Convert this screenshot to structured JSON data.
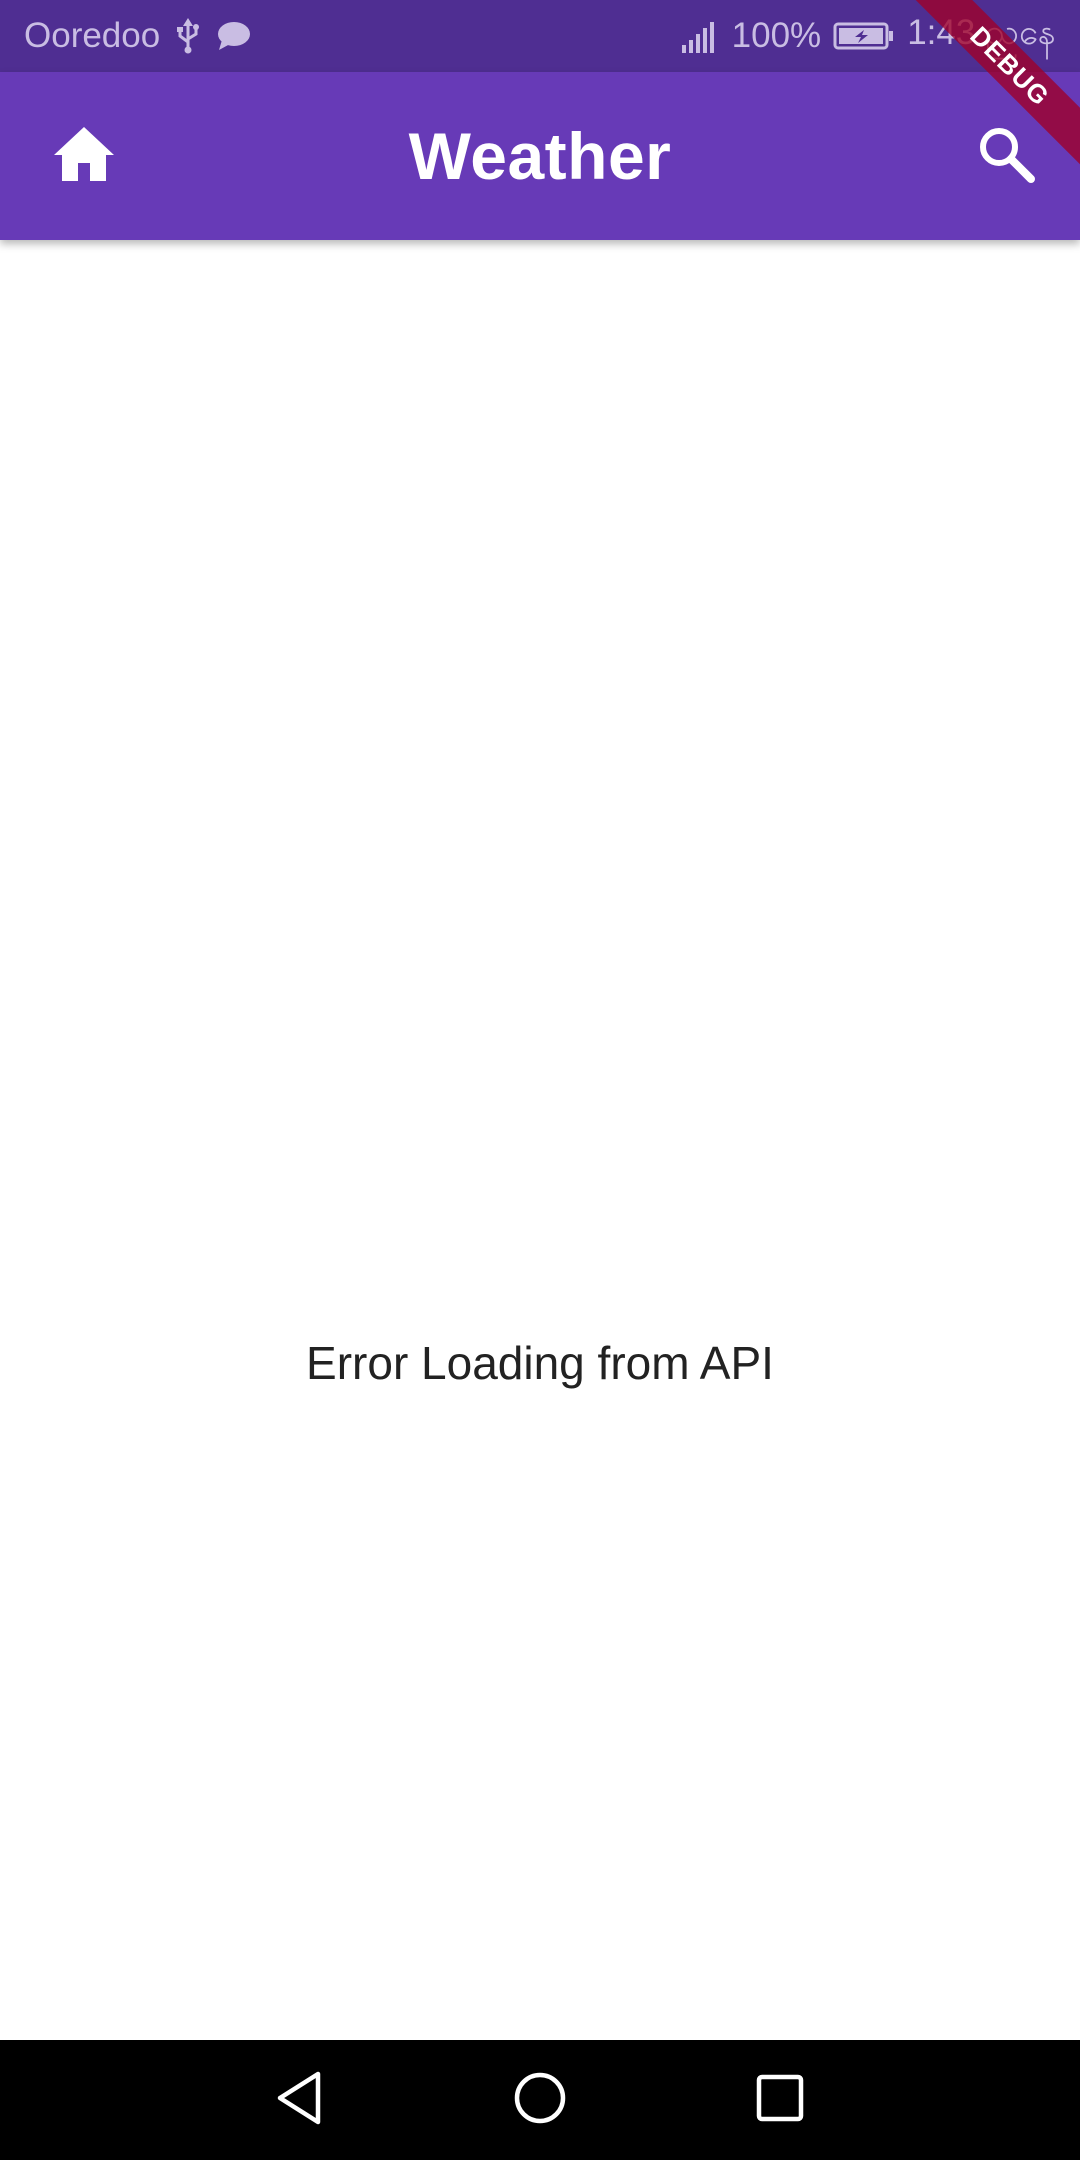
{
  "status_bar": {
    "carrier": "Ooredoo",
    "battery": "100%",
    "time": "1:43 ညနေ",
    "icons": [
      "usb-icon",
      "message-icon",
      "signal-icon",
      "battery-icon"
    ]
  },
  "app_bar": {
    "title": "Weather",
    "leading_icon": "home-icon",
    "trailing_icon": "search-icon",
    "color": "#673ab7"
  },
  "debug_banner": "DEBUG",
  "main": {
    "message": "Error Loading from API"
  },
  "nav_bar": {
    "icons": [
      "back-icon",
      "home-circle-icon",
      "recents-icon"
    ]
  }
}
